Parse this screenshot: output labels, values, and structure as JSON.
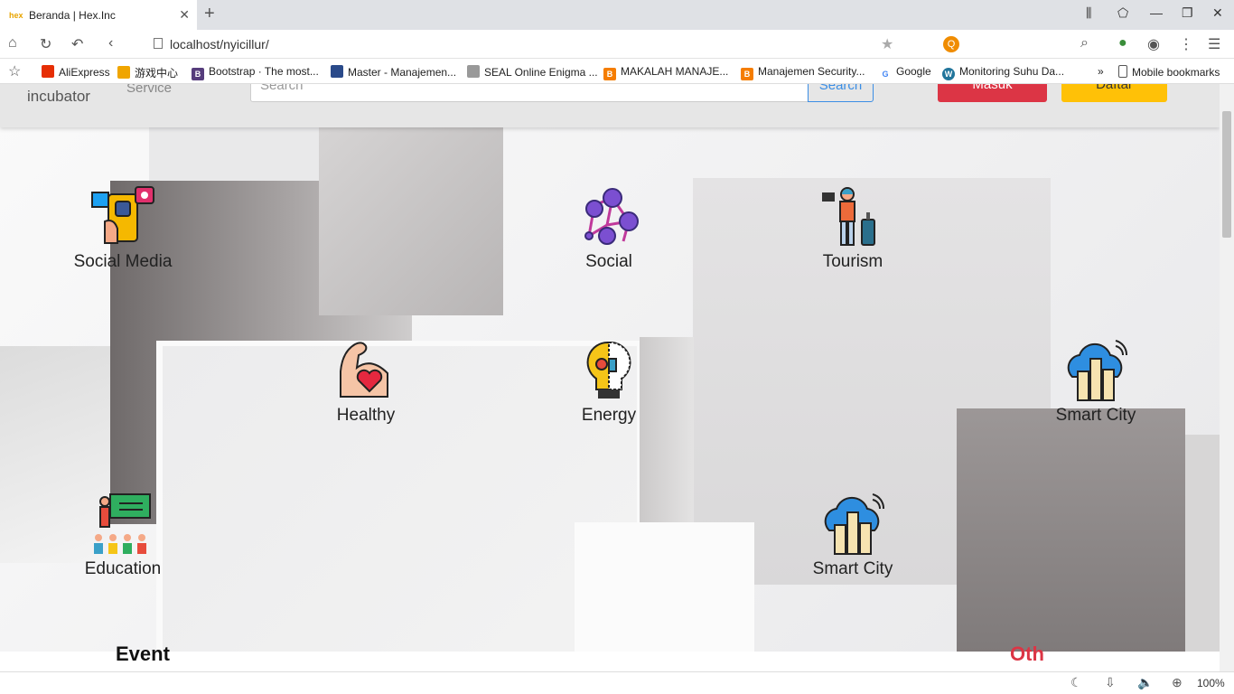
{
  "browser": {
    "tab_title": "Beranda | Hex.Inc",
    "favicon_text": "hex",
    "url": "localhost/nyicillur/",
    "zoom": "100%",
    "bookmarks": [
      "AliExpress",
      "游戏中心",
      "Bootstrap · The most...",
      "Master - Manajemen...",
      "SEAL Online Enigma ...",
      "MAKALAH MANAJE...",
      "Manajemen Security...",
      "Google",
      "Monitoring Suhu Da..."
    ],
    "mobile_bookmarks": "Mobile bookmarks",
    "more_bookmarks": "»"
  },
  "header": {
    "logo_sub": "incubator",
    "service": "Service",
    "search_placeholder": "Search",
    "search_button": "Search",
    "login_button": "Masuk",
    "register_button": "Daftar"
  },
  "categories": [
    {
      "label": "Social Media",
      "icon": "social-media-icon"
    },
    {
      "label": "Social",
      "icon": "social-network-icon"
    },
    {
      "label": "Tourism",
      "icon": "tourism-icon"
    },
    {
      "label": "Healthy",
      "icon": "healthy-icon"
    },
    {
      "label": "Energy",
      "icon": "energy-icon"
    },
    {
      "label": "Smart City",
      "icon": "smart-city-icon"
    },
    {
      "label": "Education",
      "icon": "education-icon"
    },
    {
      "label": "Smart City",
      "icon": "smart-city-icon"
    }
  ],
  "footer_partial": {
    "left": "Event",
    "right": "Oth"
  }
}
